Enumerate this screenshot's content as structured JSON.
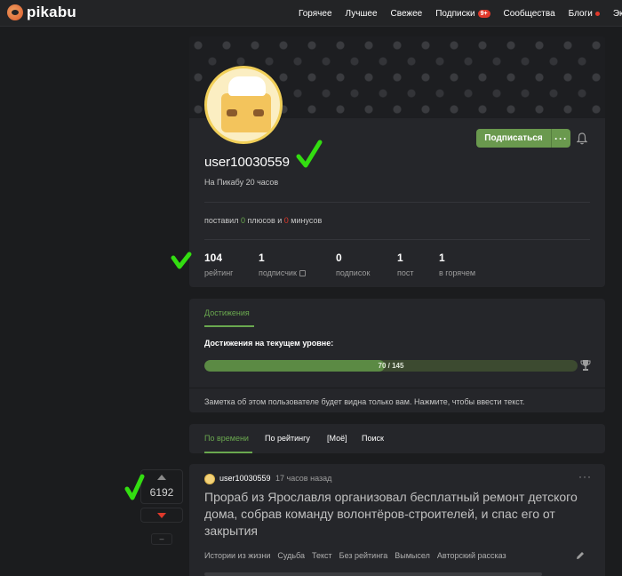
{
  "header": {
    "logo_text": "pikabu",
    "nav": [
      {
        "label": "Горячее"
      },
      {
        "label": "Лучшее"
      },
      {
        "label": "Свежее"
      },
      {
        "label": "Подписки",
        "badge": "9+"
      },
      {
        "label": "Сообщества"
      },
      {
        "label": "Блоги"
      },
      {
        "label": "Экс"
      }
    ]
  },
  "profile": {
    "subscribe_label": "Подписаться",
    "more_label": "···",
    "username": "user10030559",
    "since": "На Пикабу 20 часов",
    "votes": {
      "prefix": "поставил ",
      "plus": "0",
      "middle": " плюсов и ",
      "minus": "0",
      "suffix": " минусов"
    },
    "stats": [
      {
        "value": "104",
        "label": "рейтинг"
      },
      {
        "value": "1",
        "label": "подписчик"
      },
      {
        "value": "0",
        "label": "подписок"
      },
      {
        "value": "1",
        "label": "пост"
      },
      {
        "value": "1",
        "label": "в горячем"
      }
    ]
  },
  "achievements": {
    "tab": "Достижения",
    "title": "Достижения на текущем уровне:",
    "progress_text": "70 / 145",
    "progress_fraction": 0.4828,
    "note": "Заметка об этом пользователе будет видна только вам. Нажмите, чтобы ввести текст."
  },
  "sort_tabs": [
    "По времени",
    "По рейтингу",
    "[Моё]",
    "Поиск"
  ],
  "post": {
    "score": "6192",
    "minus_label": "–",
    "author": "user10030559",
    "time": "17 часов назад",
    "more_label": "···",
    "title": "Прораб из Ярославля организовал бесплатный ремонт детского дома, собрав команду волонтёров-строителей, и спас его от закрытия",
    "tags": [
      "Истории из жизни",
      "Судьба",
      "Текст",
      "Без рейтинга",
      "Вымысел",
      "Авторский рассказ"
    ]
  },
  "colors": {
    "accent_green": "#6aa84f",
    "accent_red": "#e0392b",
    "checkmark": "#33dd11"
  }
}
